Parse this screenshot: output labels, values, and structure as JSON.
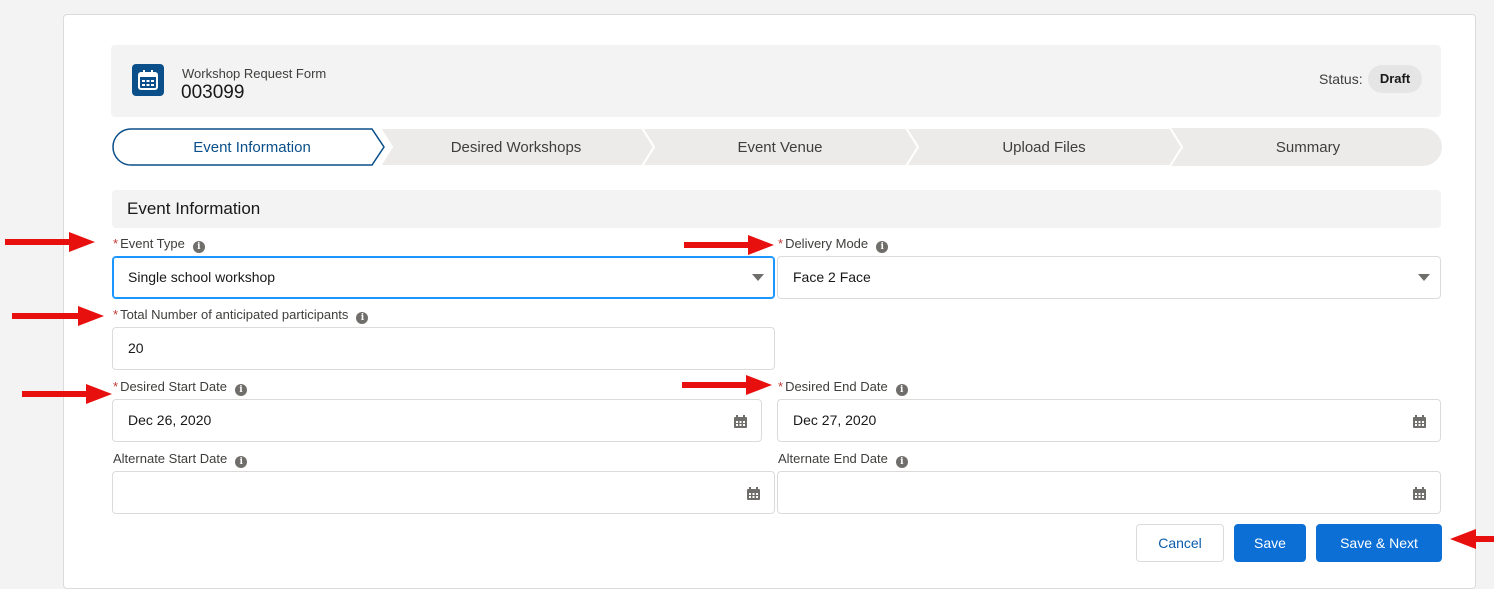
{
  "record": {
    "type": "Workshop Request Form",
    "name": "003099",
    "status_label": "Status:",
    "status_value": "Draft"
  },
  "path": {
    "steps": [
      {
        "label": "Event Information",
        "active": true
      },
      {
        "label": "Desired Workshops",
        "active": false
      },
      {
        "label": "Event Venue",
        "active": false
      },
      {
        "label": "Upload Files",
        "active": false
      },
      {
        "label": "Summary",
        "active": false
      }
    ]
  },
  "section": {
    "title": "Event Information"
  },
  "fields": {
    "event_type": {
      "label": "Event Type",
      "required_mark": "*",
      "value": "Single school workshop"
    },
    "delivery_mode": {
      "label": "Delivery Mode",
      "required_mark": "*",
      "value": "Face 2 Face"
    },
    "participants": {
      "label": "Total Number of anticipated participants",
      "required_mark": "*",
      "value": "20"
    },
    "desired_start": {
      "label": "Desired Start Date",
      "required_mark": "*",
      "value": "Dec 26, 2020"
    },
    "desired_end": {
      "label": "Desired End Date",
      "required_mark": "*",
      "value": "Dec 27, 2020"
    },
    "alternate_start": {
      "label": "Alternate Start Date",
      "value": ""
    },
    "alternate_end": {
      "label": "Alternate End Date",
      "value": ""
    }
  },
  "info_glyph": "i",
  "buttons": {
    "cancel": "Cancel",
    "save": "Save",
    "save_next": "Save & Next"
  },
  "colors": {
    "brand": "#0b6fd6",
    "record_icon": "#0b4f8a",
    "required": "#c23934",
    "annotation_arrow": "#e8100e",
    "focus": "#1b96ff"
  },
  "icons": {
    "record": "calendar-icon",
    "date_picker": "calendar-icon",
    "info": "info-icon",
    "picklist": "caret-down-icon"
  }
}
